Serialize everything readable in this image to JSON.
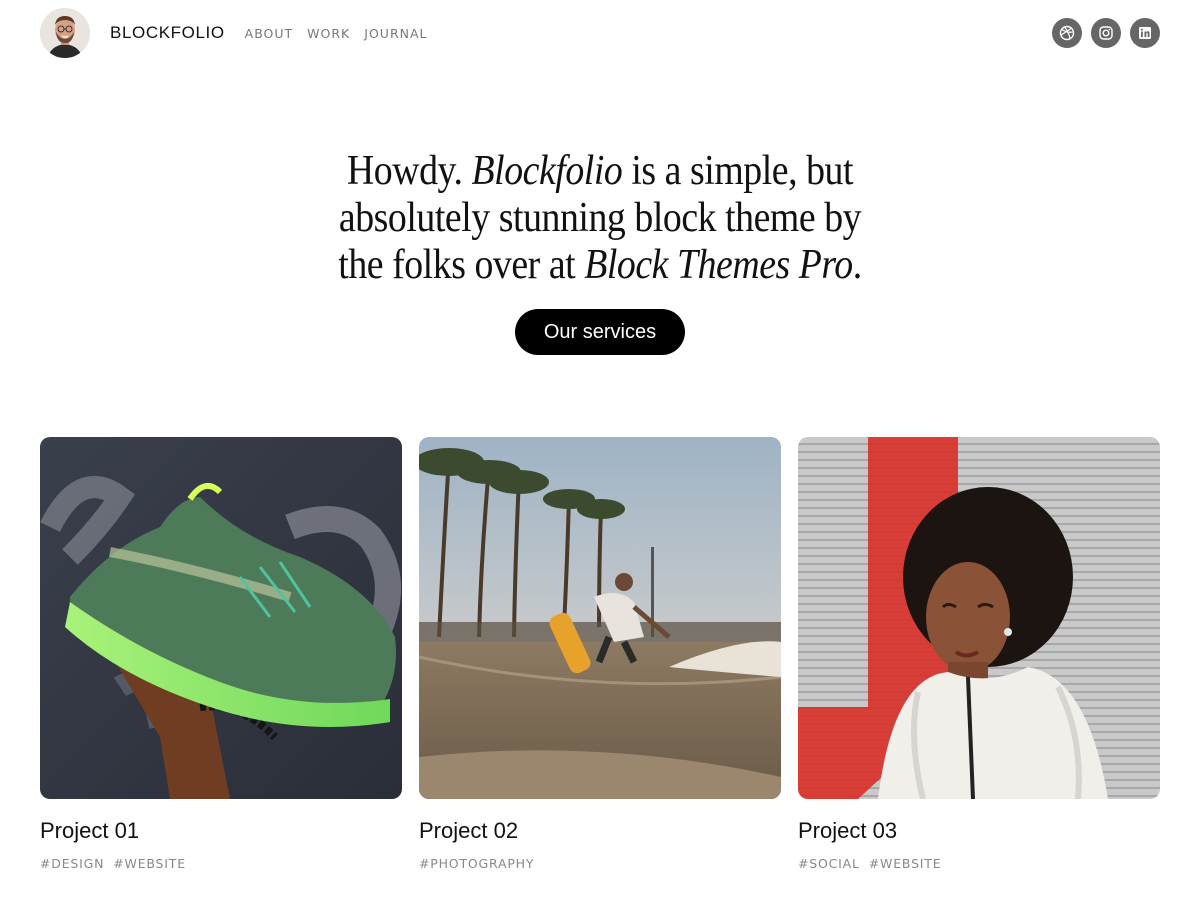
{
  "header": {
    "brand": "BLOCKFOLIO",
    "nav": [
      {
        "label": "ABOUT"
      },
      {
        "label": "WORK"
      },
      {
        "label": "JOURNAL"
      }
    ],
    "social": [
      {
        "icon": "dribbble-icon"
      },
      {
        "icon": "instagram-icon"
      },
      {
        "icon": "linkedin-icon"
      }
    ]
  },
  "hero": {
    "line1_a": "Howdy. ",
    "line1_em": "Blockfolio",
    "line1_b": " is a simple, but",
    "line2": "absolutely stunning block theme by",
    "line3_a": "the folks over at ",
    "line3_em": "Block Themes Pro",
    "line3_b": ".",
    "button_label": "Our services"
  },
  "projects": [
    {
      "title": "Project 01",
      "tags": [
        "#DESIGN",
        "#WEBSITE"
      ],
      "image": "green-sneaker-photo"
    },
    {
      "title": "Project 02",
      "tags": [
        "#PHOTOGRAPHY"
      ],
      "image": "skatepark-photo"
    },
    {
      "title": "Project 03",
      "tags": [
        "#SOCIAL",
        "#WEBSITE"
      ],
      "image": "portrait-photo"
    }
  ],
  "colors": {
    "accent_button": "#000000",
    "social_icon_bg": "#666666",
    "nav_text": "#777777",
    "tag_text": "#888888"
  }
}
